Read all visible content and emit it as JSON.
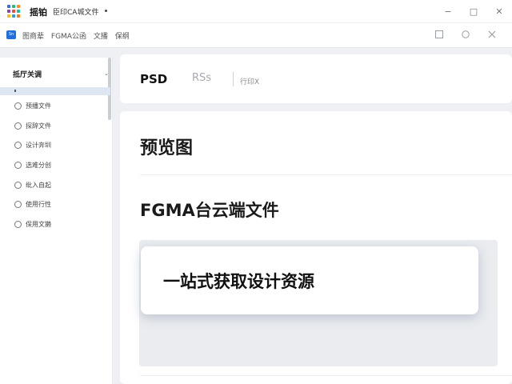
{
  "window": {
    "app_name": "摇铂",
    "doc_title": "臣印CA城文件",
    "controls": {
      "minimize": "−",
      "maximize": "□",
      "close": "✕"
    }
  },
  "address_bar": {
    "favicon_text": "Sn",
    "crumbs": [
      "图商辈",
      "FGMA公函",
      "文播",
      "保纲"
    ],
    "icons": [
      "square-icon",
      "circle-icon",
      "close-icon"
    ]
  },
  "sidebar": {
    "header": "抵厅关调",
    "caret": "⌄",
    "items": [
      {
        "label": "预播文件",
        "icon": "link-icon"
      },
      {
        "label": "探辞文件",
        "icon": "target-icon"
      },
      {
        "label": "设计奔圳",
        "icon": "gear-icon"
      },
      {
        "label": "选难分创",
        "icon": "globe-icon"
      },
      {
        "label": "纰入自起",
        "icon": "refresh-icon"
      },
      {
        "label": "使用行性",
        "icon": "user-icon"
      },
      {
        "label": "保用文獭",
        "icon": "shield-icon"
      }
    ]
  },
  "tabs": {
    "psd": "PSD",
    "rss": "RSs",
    "third": "行印X"
  },
  "main": {
    "preview_heading": "预览图",
    "figma_heading": "FGMA台云端文件",
    "feature_text": "一站式获取设计资源"
  },
  "colors": {
    "accent": "#1e6fe0",
    "background": "#eef0f4",
    "selected": "#dfe6f3"
  }
}
